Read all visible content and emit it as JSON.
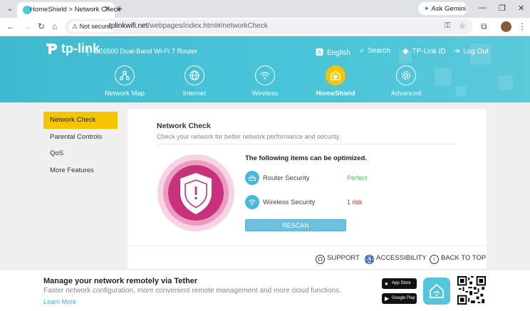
{
  "browser": {
    "tab_title": "HomeShield > Network Check",
    "new_tab": "+",
    "ask_gemini": "Ask Gemini",
    "not_secure": "Not secure",
    "url_host": "tplinkwifi.net",
    "url_path": "/webpages/index.html#/networkCheck"
  },
  "header": {
    "logo": "tp-link",
    "model": "BE6500 Dual-Band Wi-Fi 7 Router",
    "links": {
      "language": "English",
      "search": "Search",
      "tplink_id": "TP-Link ID",
      "logout": "Log Out"
    },
    "nav": [
      {
        "label": "Network Map",
        "icon": "network-map-icon"
      },
      {
        "label": "Internet",
        "icon": "globe-icon"
      },
      {
        "label": "Wireless",
        "icon": "wifi-icon"
      },
      {
        "label": "HomeShield",
        "icon": "homeshield-icon",
        "active": true
      },
      {
        "label": "Advanced",
        "icon": "gear-icon"
      }
    ]
  },
  "sidebar": {
    "items": [
      {
        "label": "Network Check",
        "active": true
      },
      {
        "label": "Parental Controls"
      },
      {
        "label": "QoS"
      },
      {
        "label": "More Features"
      }
    ]
  },
  "main": {
    "title": "Network Check",
    "subtitle": "Check your network for better network performance and security.",
    "optimize_title": "The following items can be optimized.",
    "checks": [
      {
        "label": "Router Security",
        "status": "Perfect",
        "status_color": "#5cb85c",
        "icon": "router-icon"
      },
      {
        "label": "Wireless Security",
        "status": "1 risk",
        "status_color": "#c9302c",
        "icon": "wifi-icon"
      }
    ],
    "rescan": "RESCAN",
    "footer": {
      "support": "SUPPORT",
      "accessibility": "ACCESSIBILITY",
      "back_to_top": "BACK TO TOP"
    }
  },
  "banner": {
    "title": "Manage your network remotely via Tether",
    "text": "Faster network configuration, more convenient remote management and more cloud functions.",
    "learn_more": "Learn More",
    "app_store": "App Store",
    "google_play": "Google Play"
  },
  "colors": {
    "header": "#46c0d6",
    "accent": "#f5c500",
    "shield": "#c8327a"
  }
}
